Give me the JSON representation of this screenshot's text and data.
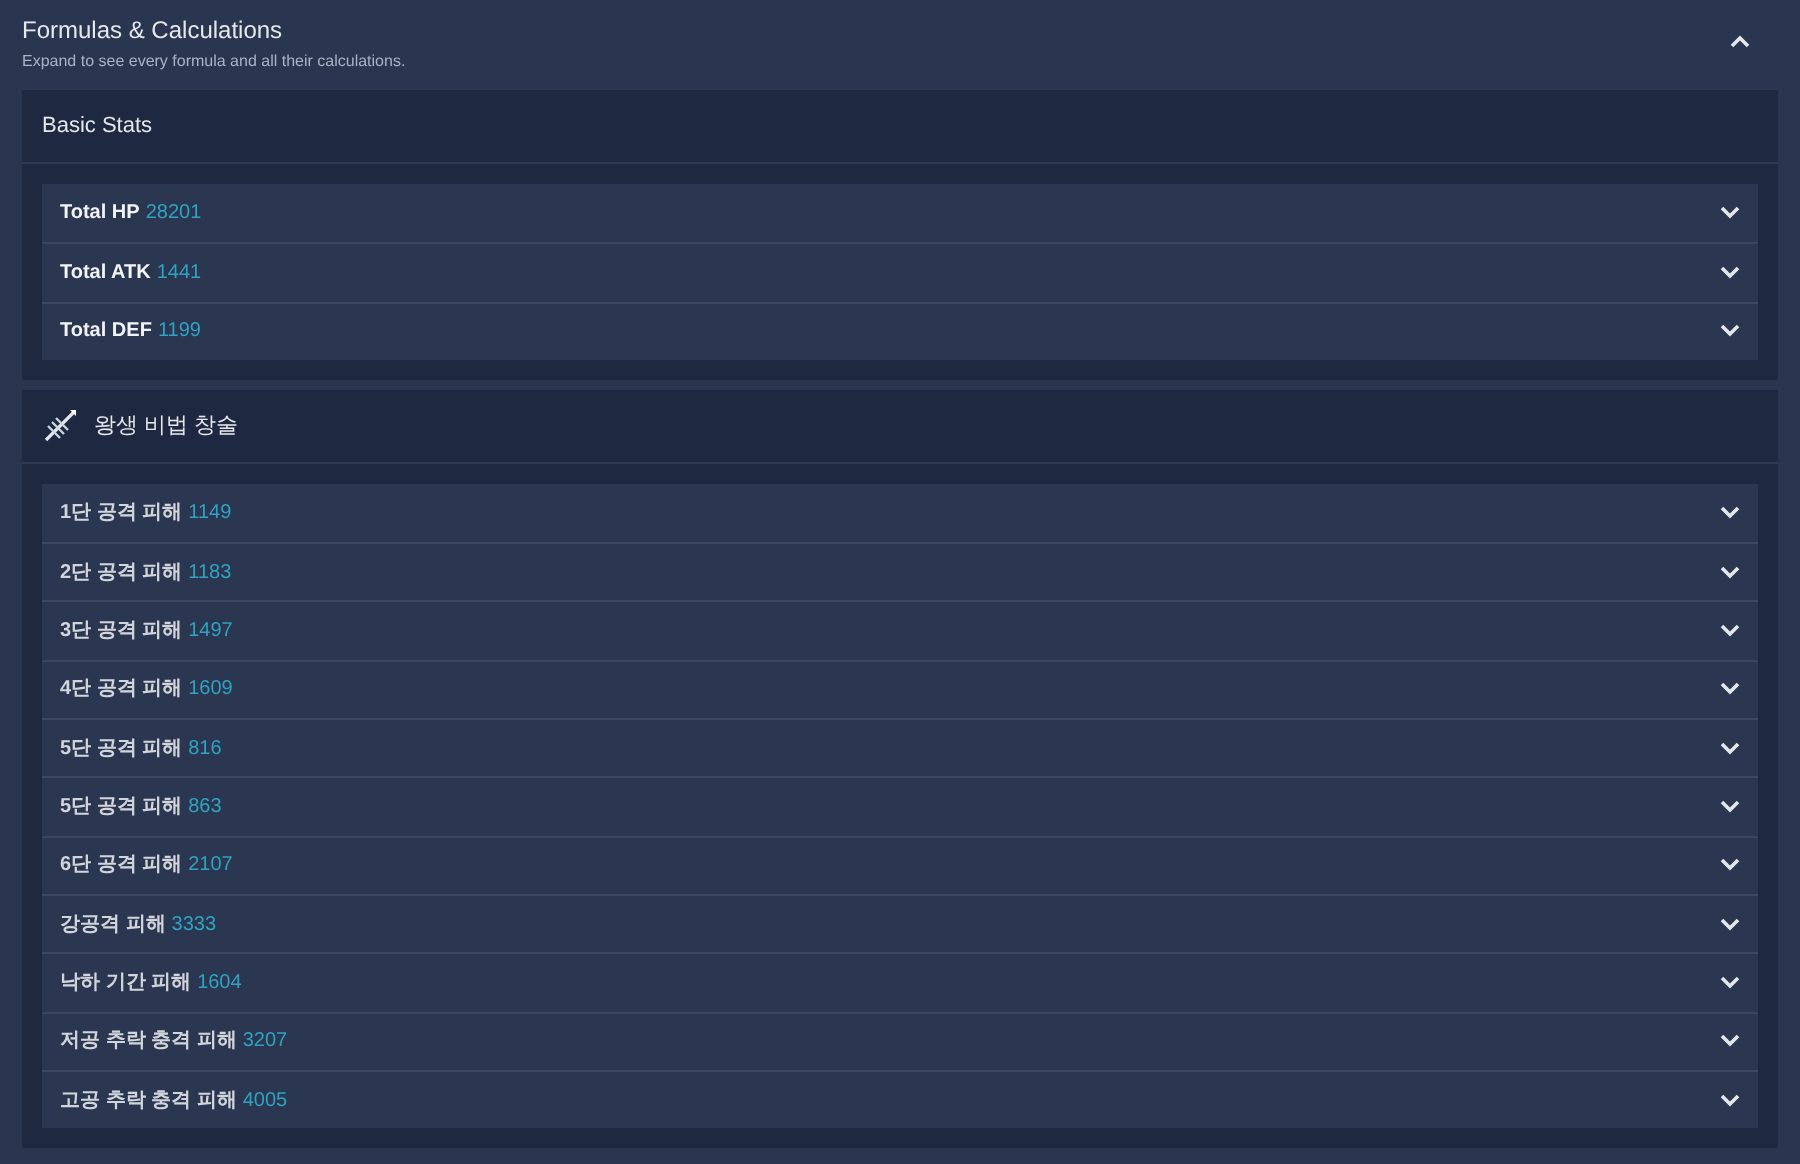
{
  "panel": {
    "title": "Formulas & Calculations",
    "subtitle": "Expand to see every formula and all their calculations.",
    "expanded": true
  },
  "sections": [
    {
      "title": "Basic Stats",
      "icon": false,
      "rows": [
        {
          "label": "Total HP",
          "value": "28201",
          "expanded": false
        },
        {
          "label": "Total ATK",
          "value": "1441",
          "expanded": false
        },
        {
          "label": "Total DEF",
          "value": "1199",
          "expanded": false
        }
      ]
    },
    {
      "title": "왕생 비법 창술",
      "icon": true,
      "rows": [
        {
          "label": "1단 공격 피해",
          "value": "1149",
          "expanded": false
        },
        {
          "label": "2단 공격 피해",
          "value": "1183",
          "expanded": false
        },
        {
          "label": "3단 공격 피해",
          "value": "1497",
          "expanded": false
        },
        {
          "label": "4단 공격 피해",
          "value": "1609",
          "expanded": false
        },
        {
          "label": "5단 공격 피해",
          "value": "816",
          "expanded": false
        },
        {
          "label": "5단 공격 피해",
          "value": "863",
          "expanded": false
        },
        {
          "label": "6단 공격 피해",
          "value": "2107",
          "expanded": false
        },
        {
          "label": "강공격 피해",
          "value": "3333",
          "expanded": false
        },
        {
          "label": "낙하 기간 피해",
          "value": "1604",
          "expanded": false
        },
        {
          "label": "저공 추락 충격 피해",
          "value": "3207",
          "expanded": false
        },
        {
          "label": "고공 추락 충격 피해",
          "value": "4005",
          "expanded": false
        }
      ]
    }
  ]
}
